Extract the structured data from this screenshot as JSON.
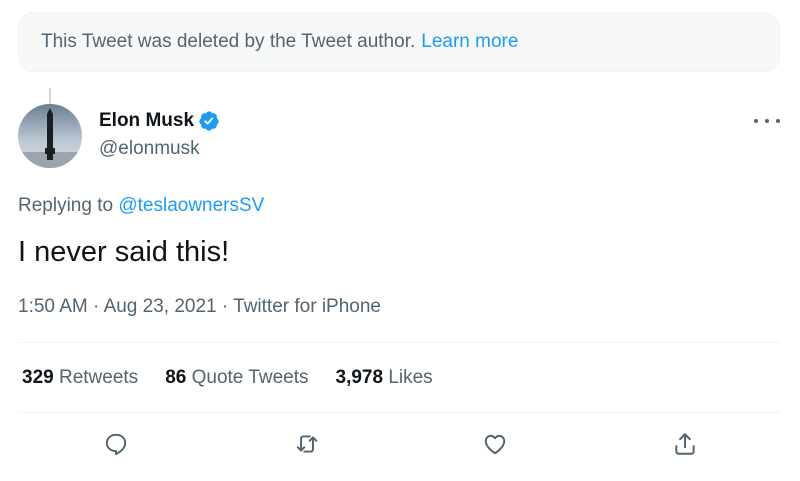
{
  "notice": {
    "text": "This Tweet was deleted by the Tweet author.",
    "link": "Learn more"
  },
  "author": {
    "name": "Elon Musk",
    "handle": "@elonmusk",
    "verified_icon": "verified-badge-icon"
  },
  "reply": {
    "prefix": "Replying to",
    "mention": "@teslaownersSV"
  },
  "tweet": {
    "text": "I never said this!"
  },
  "meta": {
    "time": "1:50 AM",
    "date": "Aug 23, 2021",
    "client": "Twitter for iPhone",
    "separator": "·"
  },
  "stats": {
    "retweets_count": "329",
    "retweets_label": "Retweets",
    "quotes_count": "86",
    "quotes_label": "Quote Tweets",
    "likes_count": "3,978",
    "likes_label": "Likes"
  },
  "actions": [
    "reply-icon",
    "retweet-icon",
    "like-icon",
    "share-icon"
  ],
  "colors": {
    "accent": "#1d9bf0",
    "text_primary": "#0f1419",
    "text_secondary": "#536471",
    "divider": "#eff3f4",
    "notice_bg": "#f7f9f9"
  }
}
